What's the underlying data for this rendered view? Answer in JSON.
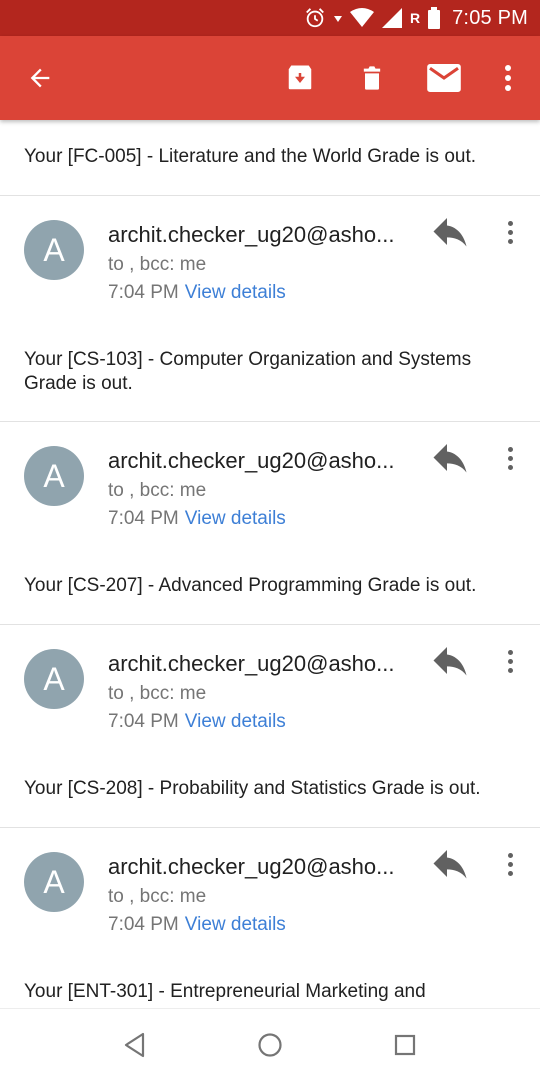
{
  "status_bar": {
    "time": "7:05 PM",
    "carrier_badge": "R",
    "icons": [
      "alarm-icon",
      "wifi-icon",
      "signal-icon",
      "battery-icon"
    ]
  },
  "app_bar": {
    "color": "#db4437",
    "actions": [
      "back-arrow-icon",
      "archive-icon",
      "delete-icon",
      "mark-unread-icon",
      "more-vert-icon"
    ]
  },
  "first_message_body": "Your [FC-005] - Literature and the World Grade is out.",
  "messages": [
    {
      "avatar_letter": "A",
      "sender": "archit.checker_ug20@asho...",
      "recipients": "to , bcc: me",
      "time": "7:04 PM",
      "details_link": "View details",
      "body": "Your [CS-103] - Computer Organization and Systems Grade is out."
    },
    {
      "avatar_letter": "A",
      "sender": "archit.checker_ug20@asho...",
      "recipients": "to , bcc: me",
      "time": "7:04 PM",
      "details_link": "View details",
      "body": "Your [CS-207] - Advanced Programming Grade is out."
    },
    {
      "avatar_letter": "A",
      "sender": "archit.checker_ug20@asho...",
      "recipients": "to , bcc: me",
      "time": "7:04 PM",
      "details_link": "View details",
      "body": "Your [CS-208] - Probability and Statistics Grade is out."
    },
    {
      "avatar_letter": "A",
      "sender": "archit.checker_ug20@asho...",
      "recipients": "to , bcc: me",
      "time": "7:04 PM",
      "details_link": "View details",
      "body": "Your [ENT-301] - Entrepreneurial Marketing and"
    }
  ],
  "nav_bar": {
    "buttons": [
      "back-triangle-icon",
      "home-circle-icon",
      "recents-square-icon"
    ]
  },
  "colors": {
    "status_bar": "#b3261e",
    "app_bar": "#db4437",
    "avatar": "#90a4ae",
    "link": "#3d7fd6"
  }
}
